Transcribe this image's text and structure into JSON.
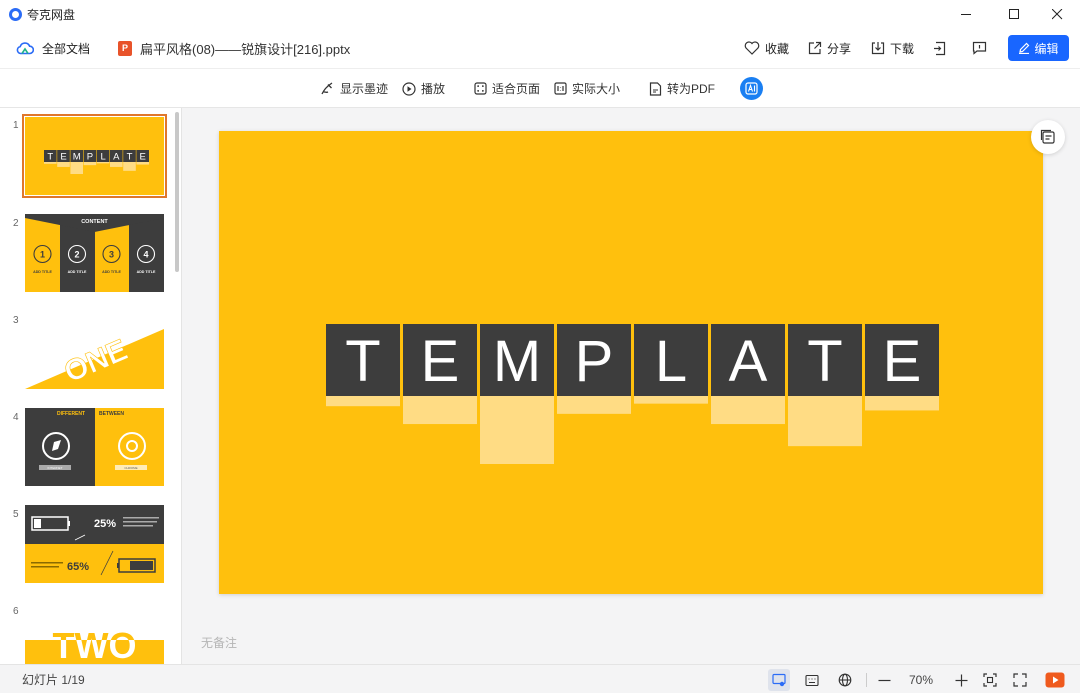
{
  "app": {
    "name": "夸克网盘"
  },
  "header": {
    "all_docs": "全部文档",
    "file_icon_letter": "P",
    "file_name": "扁平风格(08)——锐旗设计[216].pptx",
    "favorite": "收藏",
    "share": "分享",
    "download": "下载",
    "edit": "编辑"
  },
  "toolbar": {
    "ink": "显示墨迹",
    "play": "播放",
    "fit_page": "适合页面",
    "actual_size": "实际大小",
    "to_pdf": "转为PDF"
  },
  "thumbnails": [
    {
      "num": "1",
      "selected": true
    },
    {
      "num": "2",
      "title": "CONTENT",
      "items": [
        "1",
        "2",
        "3",
        "4"
      ],
      "caption": "ADD TITLE"
    },
    {
      "num": "3",
      "word": "ONE"
    },
    {
      "num": "4",
      "left": "DIFFERENT",
      "right": "BETWEEN",
      "left_tag": "INTERNET",
      "right_tag": "CHROME"
    },
    {
      "num": "5",
      "top_pct": "25%",
      "bottom_pct": "65%"
    },
    {
      "num": "6",
      "word": "TWO"
    }
  ],
  "slide": {
    "letters": [
      "T",
      "E",
      "M",
      "P",
      "L",
      "A",
      "T",
      "E"
    ],
    "background": "#ffc00d",
    "tile_color": "#3d3d3d",
    "drop_levels": [
      0.12,
      0.33,
      0.8,
      0.21,
      0.09,
      0.33,
      0.59,
      0.17
    ]
  },
  "notes": "无备注",
  "status": {
    "slide_label": "幻灯片 1/19",
    "zoom": "70%"
  },
  "colors": {
    "accent": "#1966ff",
    "slide_yellow": "#ffc00d",
    "thumb_border": "#e0772b"
  }
}
